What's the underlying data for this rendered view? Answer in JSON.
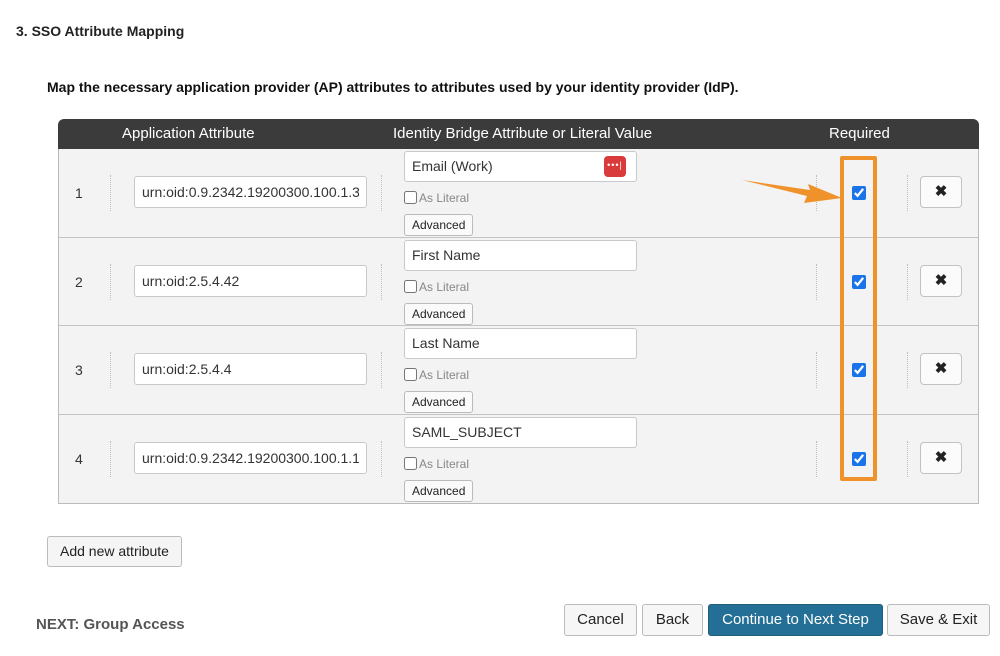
{
  "section": {
    "title": "3. SSO Attribute Mapping"
  },
  "instructions": "Map the necessary application provider (AP) attributes to attributes used by your identity provider (IdP).",
  "table": {
    "headers": {
      "application": "Application Attribute",
      "identity": "Identity Bridge Attribute or Literal Value",
      "required": "Required"
    },
    "rows": [
      {
        "number": "1",
        "app_value": "urn:oid:0.9.2342.19200300.100.1.3",
        "idb_value": "Email (Work)",
        "literal_label": "As Literal",
        "advanced_label": "Advanced",
        "required": true,
        "delete_glyph": "✖"
      },
      {
        "number": "2",
        "app_value": "urn:oid:2.5.4.42",
        "idb_value": "First Name",
        "literal_label": "As Literal",
        "advanced_label": "Advanced",
        "required": true,
        "delete_glyph": "✖"
      },
      {
        "number": "3",
        "app_value": "urn:oid:2.5.4.4",
        "idb_value": "Last Name",
        "literal_label": "As Literal",
        "advanced_label": "Advanced",
        "required": true,
        "delete_glyph": "✖"
      },
      {
        "number": "4",
        "app_value": "urn:oid:0.9.2342.19200300.100.1.1",
        "idb_value": "SAML_SUBJECT",
        "literal_label": "As Literal",
        "advanced_label": "Advanced",
        "required": true,
        "delete_glyph": "✖"
      }
    ]
  },
  "icons": {
    "password_manager": "password-manager-icon",
    "delete": "close-x-icon",
    "annotation": "orange-arrow"
  },
  "colors": {
    "highlight": "#f0922b",
    "primary_button": "#246f95",
    "password_icon": "#d93a3a",
    "header_bg": "#3b3b3b"
  },
  "actions": {
    "add_attribute": "Add new attribute",
    "next_label": "NEXT: Group Access",
    "cancel": "Cancel",
    "back": "Back",
    "continue": "Continue to Next Step",
    "save_exit": "Save & Exit"
  }
}
